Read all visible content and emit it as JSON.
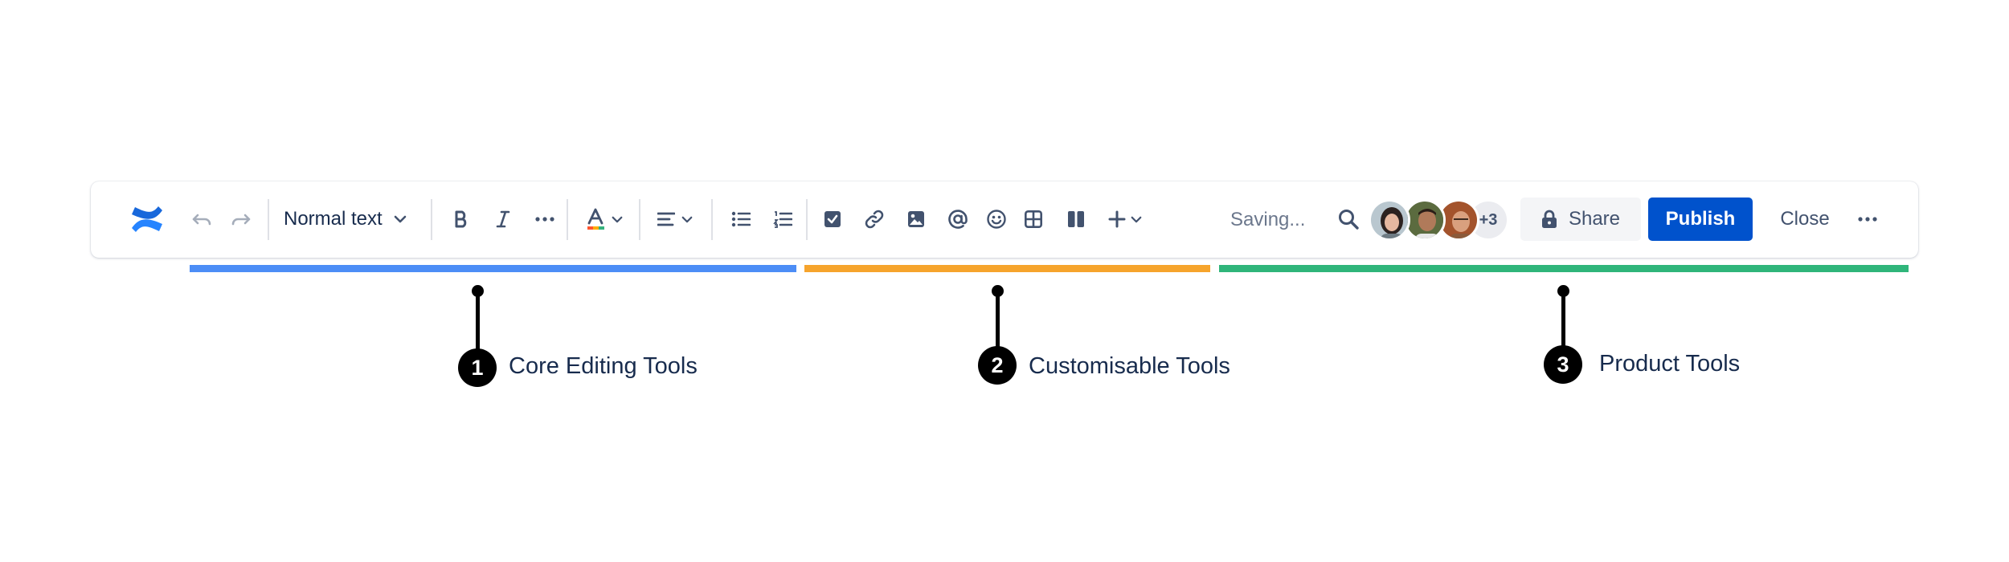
{
  "toolbar": {
    "text_style": "Normal text",
    "saving_status": "Saving...",
    "avatars_more": "+3",
    "share_label": "Share",
    "publish_label": "Publish",
    "close_label": "Close"
  },
  "sections": [
    {
      "number": "1",
      "label": "Core Editing Tools",
      "color": "#4c8df6"
    },
    {
      "number": "2",
      "label": "Customisable Tools",
      "color": "#f6a42c"
    },
    {
      "number": "3",
      "label": "Product Tools",
      "color": "#2fb57a"
    }
  ],
  "colors": {
    "primary": "#0052cc",
    "logo": "#2684ff",
    "icon": "#42526e"
  }
}
